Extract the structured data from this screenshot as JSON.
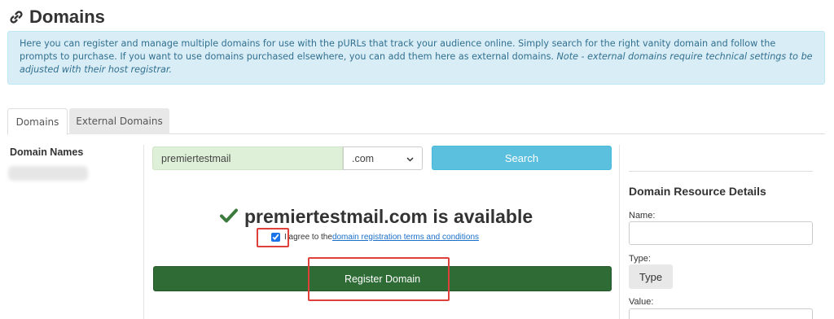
{
  "page": {
    "title": "Domains",
    "title_icon": "link-icon"
  },
  "info": {
    "text": "Here you can register and manage multiple domains for use with the pURLs that track your audience online. Simply search for the right vanity domain and follow the prompts to purchase. If you want to use domains purchased elsewhere, you can add them here as external domains. ",
    "note": "Note - external domains require technical settings to be adjusted with their host registrar."
  },
  "tabs": [
    {
      "label": "Domains",
      "active": true
    },
    {
      "label": "External Domains",
      "active": false
    }
  ],
  "sidebar": {
    "heading": "Domain Names"
  },
  "search": {
    "domain_value": "premiertestmail",
    "tld_selected": ".com",
    "button_label": "Search"
  },
  "result": {
    "icon": "checkmark-icon",
    "icon_color": "#3d7a3d",
    "message": "premiertestmail.com is available"
  },
  "agreement": {
    "checked": true,
    "text": "I agree to the ",
    "link_text": "domain registration terms and conditions"
  },
  "register": {
    "button_label": "Register Domain",
    "color": "#2e6b35"
  },
  "resource": {
    "heading": "Domain Resource Details",
    "name_label": "Name:",
    "type_label": "Type:",
    "type_button": "Type",
    "value_label": "Value:"
  },
  "colors": {
    "info_bg": "#d9edf7",
    "info_text": "#31708f",
    "search_button": "#5bc0de",
    "highlight_box": "#e0403a"
  }
}
